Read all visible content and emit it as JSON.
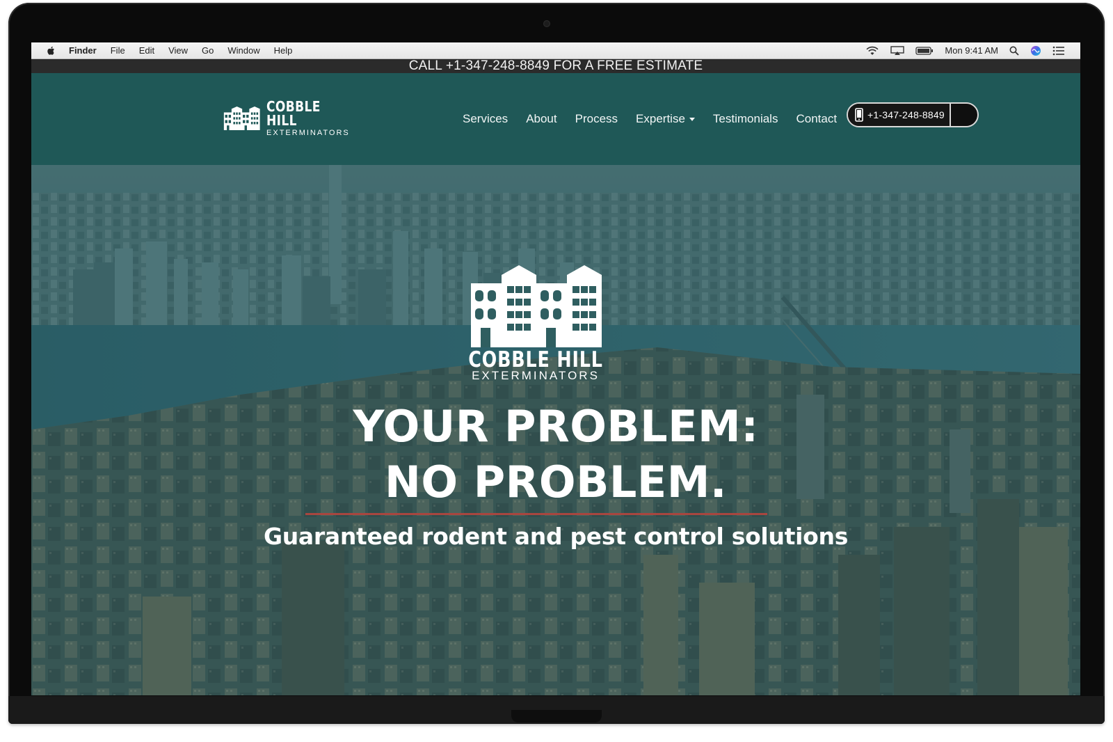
{
  "menubar": {
    "app_name": "Finder",
    "menus": [
      "File",
      "Edit",
      "View",
      "Go",
      "Window",
      "Help"
    ],
    "clock": "Mon 9:41 AM",
    "status_icons": [
      "wifi-icon",
      "airplay-icon",
      "battery-icon",
      "spotlight-search-icon",
      "siri-icon",
      "notification-center-icon"
    ]
  },
  "promo": {
    "text": "CALL +1-347-248-8849 FOR A FREE ESTIMATE"
  },
  "navbar": {
    "brand_main": "COBBLE HILL",
    "brand_sub": "EXTERMINATORS",
    "links": {
      "services": "Services",
      "about": "About",
      "process": "Process",
      "expertise": "Expertise",
      "testimonials": "Testimonials",
      "contact": "Contact"
    },
    "phone": "+1-347-248-8849"
  },
  "hero": {
    "brand_main": "COBBLE HILL",
    "brand_sub": "EXTERMINATORS",
    "headline_line1": "YOUR PROBLEM:",
    "headline_line2": "NO PROBLEM.",
    "tagline": "Guaranteed rodent and pest control solutions"
  },
  "colors": {
    "navbar_bg": "#1f5857",
    "promo_bg": "#2b2b2b",
    "divider": "#a8463f",
    "hero_overlay": "#185256"
  }
}
